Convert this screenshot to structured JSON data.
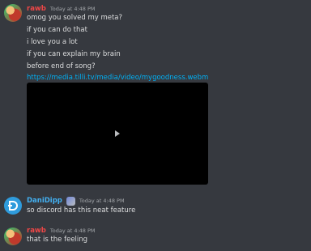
{
  "messages": [
    {
      "author": "rawb",
      "timestamp": "Today at 4:48 PM",
      "lines": [
        "omog you solved my meta?",
        "if you can do that",
        "i love you a lot",
        "if you can explain my brain",
        "before end of song?"
      ],
      "link": "https://media.tilli.tv/media/video/mygoodness.webm"
    },
    {
      "author": "DaniDipp",
      "timestamp": "Today at 4:48 PM",
      "lines": [
        "so discord has this neat feature"
      ]
    },
    {
      "author": "rawb",
      "timestamp": "Today at 4:48 PM",
      "lines": [
        "that is the feeling"
      ]
    }
  ],
  "colors": {
    "background": "#36393f",
    "rawb_name": "#f04747",
    "dani_name": "#43b0f1",
    "link": "#00b0f4"
  },
  "icons": {
    "play": "play-icon",
    "dani_avatar": "discord-style-logo-icon",
    "badge": "user-badge-icon"
  }
}
